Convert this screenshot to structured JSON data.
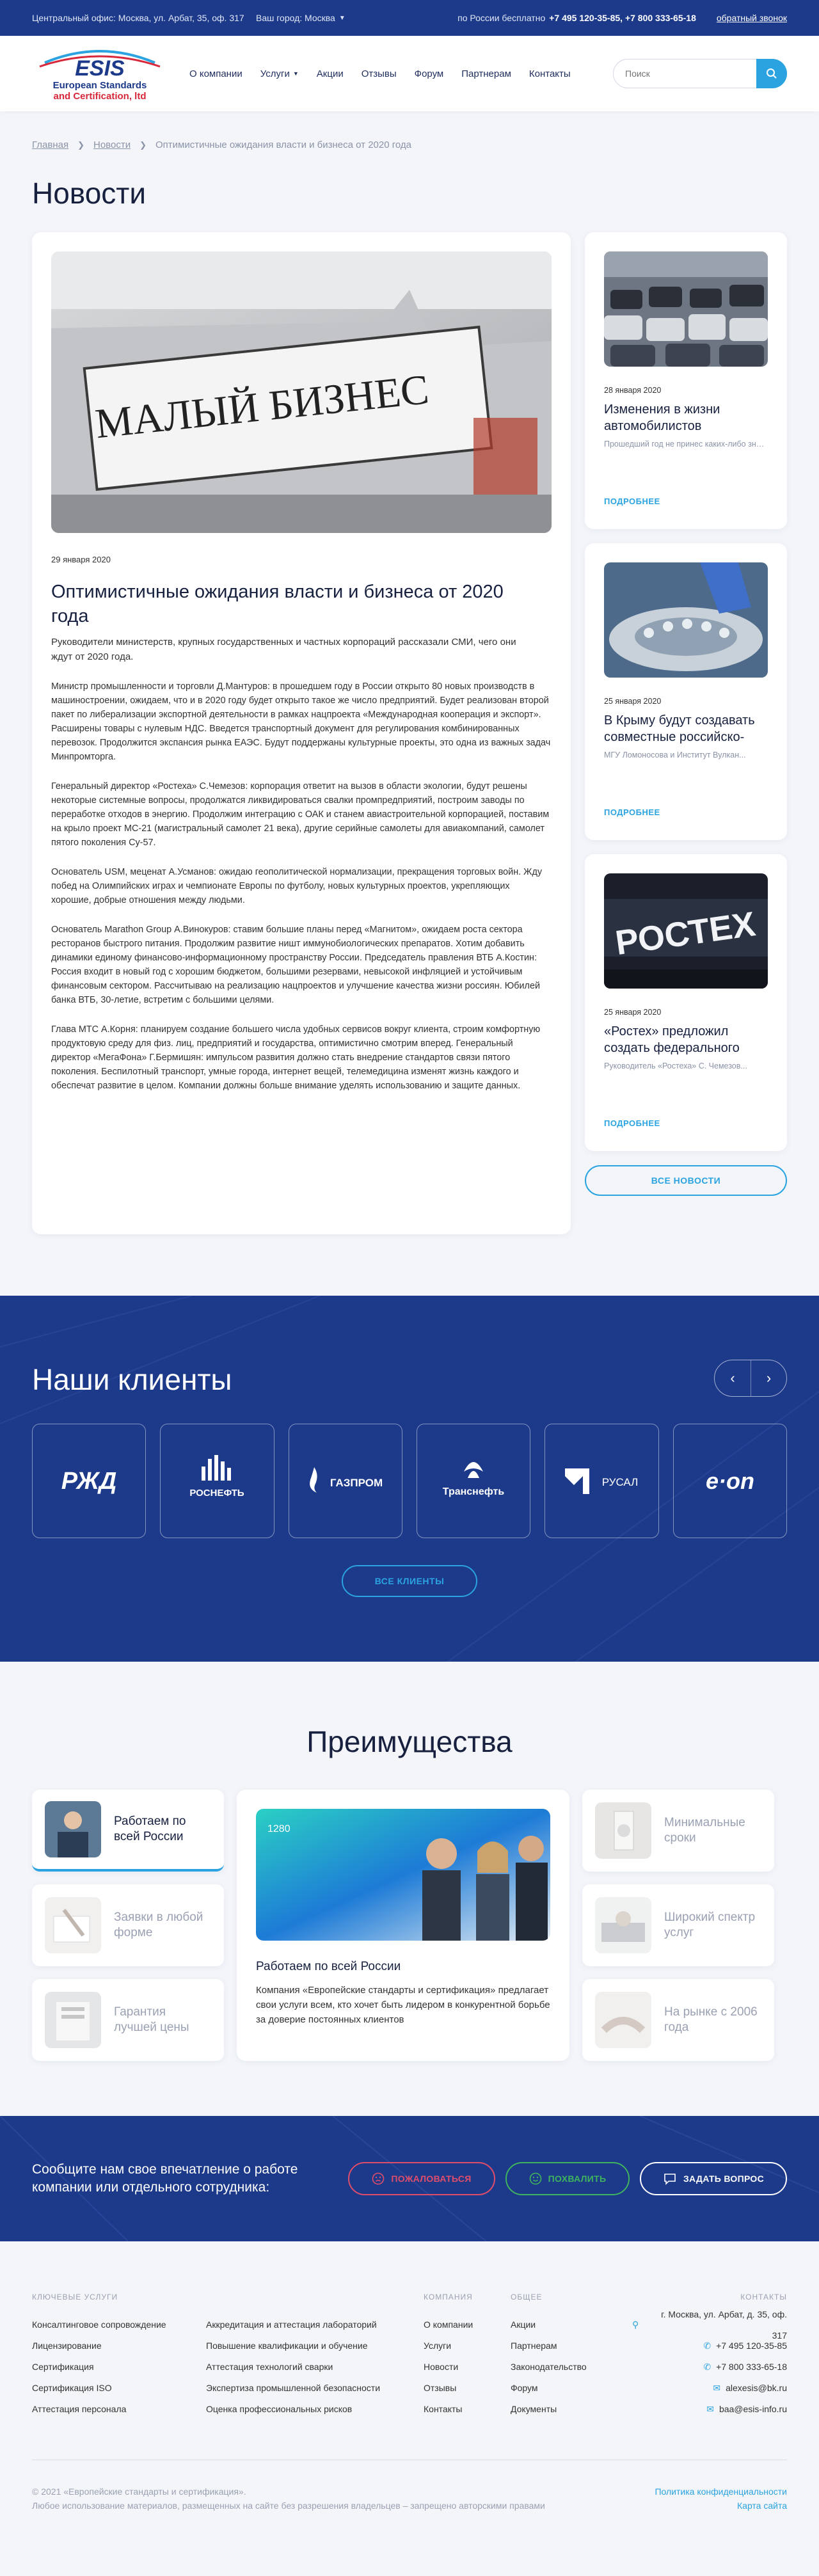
{
  "topbar": {
    "office": "Центральный офис: Москва, ул. Арбат, 35, оф. 317",
    "city": "Ваш город: Москва",
    "phones_label": "по России бесплатно",
    "phones": "+7 495 120-35-85, +7 800 333-65-18",
    "callback": "обратный звонок"
  },
  "logo": {
    "line1": "ESIS",
    "line2": "European Standards",
    "line3": "and Certification, ltd"
  },
  "nav": [
    "О компании",
    "Услуги",
    "Акции",
    "Отзывы",
    "Форум",
    "Партнерам",
    "Контакты"
  ],
  "search": {
    "placeholder": "Поиск"
  },
  "breadcrumb": {
    "home": "Главная",
    "news": "Новости",
    "current": "Оптимистичные ожидания власти и бизнеса от 2020 года"
  },
  "page_title": "Новости",
  "main_news": {
    "image_text": "МАЛЫЙ БИЗНЕС",
    "date": "29 января 2020",
    "title": "Оптимистичные ожидания власти и бизнеса от 2020 года",
    "lead": "Руководители министерств, крупных государственных и частных корпораций рассказали СМИ, чего они ждут от 2020 года.",
    "paragraphs": [
      "Министр промышленности и торговли Д.Мантуров: в прошедшем году в России открыто 80 новых производств в машиностроении, ожидаем, что и в 2020 году будет открыто такое же число предприятий. Будет реализован второй пакет по либерализации экспортной деятельности в рамках нацпроекта «Международная кооперация и экспорт». Расширены товары с нулевым НДС. Введется транспортный документ для регулирования комбинированных перевозок. Продолжится экспансия рынка ЕАЭС. Будут поддержаны культурные проекты, это одна из важных задач Минпромторга.",
      "Генеральный директор «Ростеха» С.Чемезов: корпорация ответит на вызов в области экологии, будут решены некоторые системные вопросы, продолжатся ликвидироваться свалки промпредприятий, построим заводы по переработке отходов в энергию. Продолжим интеграцию с ОАК и станем авиастроительной корпорацией, поставим на крыло проект МС-21 (магистральный самолет 21 века), другие серийные самолеты для авиакомпаний, самолет пятого поколения Су-57.",
      "Основатель USM, меценат А.Усманов: ожидаю геополитической нормализации, прекращения торговых войн. Жду побед на Олимпийских играх и чемпионате Европы по футболу, новых культурных проектов, укрепляющих хорошие, добрые отношения между людьми.",
      "Основатель Marathon Group А.Винокуров: ставим большие планы перед «Магнитом», ожидаем роста сектора ресторанов быстрого питания. Продолжим развитие ништ иммунобиологических препаратов. Хотим добавить динамики единому финансово-информационному пространству России. Председатель правления ВТБ А.Костин: Россия входит в новый год с хорошим бюджетом, большими резервами, невысокой инфляцией и устойчивым финансовым сектором. Рассчитываю на реализацию нацпроектов и улучшение качества жизни россиян. Юбилей банка ВТБ, 30-летие, встретим с большими целями.",
      "Глава МТС А.Корня: планируем создание большего числа удобных сервисов вокруг клиента, строим комфортную продуктовую среду для физ. лиц, предприятий и государства, оптимистично смотрим вперед. Генеральный директор «МегаФона» Г.Бермишян: импульсом развития должно стать внедрение стандартов связи пятого поколения. Беспилотный транспорт, умные города, интернет вещей, телемедицина изменят жизнь каждого и обеспечат развитие в целом. Компании должны больше внимание уделять использованию и защите данных."
    ]
  },
  "side_news": [
    {
      "date": "28 января 2020",
      "title": "Изменения в жизни автомобилистов",
      "sub": "Прошедший год не принес каких-либо значительных изменений в жи...",
      "more": "ПОДРОБНЕЕ"
    },
    {
      "date": "25 января 2020",
      "title": "В Крыму будут создавать совместные российско-израильские лаборато...",
      "sub": "МГУ Ломоносова и Институт Вулкан...",
      "more": "ПОДРОБНЕЕ"
    },
    {
      "date": "25 января 2020",
      "title": "«Ростех» предложил создать федерального оператора промышлен...",
      "sub": "Руководитель «Ростеха» С. Чемезов...",
      "more": "ПОДРОБНЕЕ",
      "image_text": "РОСТЕХ"
    }
  ],
  "all_news": "ВСЕ НОВОСТИ",
  "clients": {
    "title": "Наши клиенты",
    "logos": [
      "РЖД",
      "РОСНЕФТЬ",
      "ГАЗПРОМ",
      "Транснефть",
      "РУСАЛ",
      "e·on"
    ],
    "all": "ВСЕ КЛИЕНТЫ"
  },
  "advantages": {
    "title": "Преимущества",
    "items": [
      "Работаем по всей России",
      "Заявки в любой форме",
      "Гарантия лучшей цены",
      "Минимальные сроки",
      "Широкий спектр услуг",
      "На рынке с 2006 года"
    ],
    "center_title": "Работаем по всей России",
    "center_text": "Компания «Европейские стандарты и сертификация» предлагает свои услуги всем, кто хочет быть лидером в конкурентной борьбе за доверие постоянных клиентов",
    "center_img_text": "1280"
  },
  "feedback": {
    "text": "Сообщите нам свое впечатление о работе компании или отдельного сотрудника:",
    "complain": "ПОЖАЛОВАТЬСЯ",
    "praise": "ПОХВАЛИТЬ",
    "ask": "ЗАДАТЬ ВОПРОС"
  },
  "footer": {
    "col1_title": "КЛЮЧЕВЫЕ УСЛУГИ",
    "col1": [
      "Консалтинговое сопровождение",
      "Лицензирование",
      "Сертификация",
      "Сертификация ISO",
      "Аттестация персонала"
    ],
    "col2": [
      "Аккредитация и аттестация лабораторий",
      "Повышение квалификации и обучение",
      "Аттестация технологий сварки",
      "Экспертиза промышленной безопасности",
      "Оценка профессиональных рисков"
    ],
    "col3_title": "КОМПАНИЯ",
    "col3": [
      "О компании",
      "Услуги",
      "Новости",
      "Отзывы",
      "Контакты"
    ],
    "col4_title": "ОБЩЕЕ",
    "col4": [
      "Акции",
      "Партнерам",
      "Законодательство",
      "Форум",
      "Документы"
    ],
    "col5_title": "КОНТАКТЫ",
    "contacts": [
      "г. Москва, ул. Арбат, д. 35, оф. 317",
      "+7 495 120-35-85",
      "+7 800 333-65-18",
      "alexesis@bk.ru",
      "baa@esis-info.ru"
    ],
    "copyright": "© 2021 «Европейские стандарты и сертификация».",
    "notice": "Любое использование материалов, размещенных на сайте без разрешения владельцев – запрещено авторскими правами",
    "privacy": "Политика конфиденциальности",
    "sitemap": "Карта сайта"
  }
}
